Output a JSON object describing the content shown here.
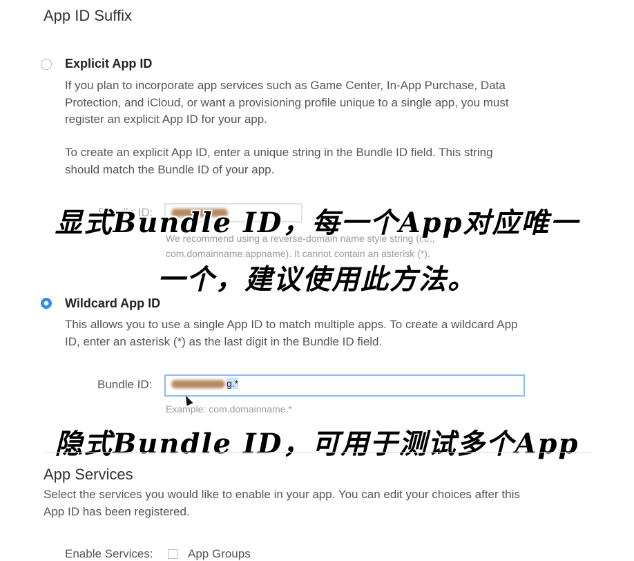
{
  "section": {
    "title": "App ID Suffix"
  },
  "explicit": {
    "title": "Explicit App ID",
    "desc1_lines": [
      "If you plan to incorporate app services such as Game Center, In-App Purchase, Data",
      "Protection, and iCloud, or want a provisioning profile unique to a single app, you must",
      "register an explicit App ID for your app."
    ],
    "desc2_lines": [
      "To create an explicit App ID, enter a unique string in the Bundle ID field. This string",
      "should match the Bundle ID of your app."
    ],
    "bundle_label": "Bundle ID:",
    "hint_lines": [
      "We recommend using a reverse-domain name style string (i.e.,",
      "com.domainname.appname). It cannot contain an asterisk (*)."
    ],
    "selected": false
  },
  "wildcard": {
    "title": "Wildcard App ID",
    "desc_lines": [
      "This allows you to use a single App ID to match multiple apps. To create a wildcard App",
      "ID, enter an asterisk (*) as the last digit in the Bundle ID field."
    ],
    "bundle_label": "Bundle ID:",
    "bundle_value_suffix": "g.*",
    "example": "Example: com.domainname.*",
    "selected": true
  },
  "services": {
    "title": "App Services",
    "desc_lines": [
      "Select the services you would like to enable in your app. You can edit your choices after this",
      "App ID has been registered."
    ],
    "enable_label": "Enable Services:",
    "first_service": "App Groups"
  },
  "annotations": {
    "explicit_line1": "显式Bundle ID，每一个App对应唯一",
    "explicit_line2": "一个，建议使用此方法。",
    "wildcard_line": "隐式Bundle ID，可用于测试多个App"
  },
  "colors": {
    "accent": "#2d8ef2",
    "input_border": "#8cbcf0"
  }
}
